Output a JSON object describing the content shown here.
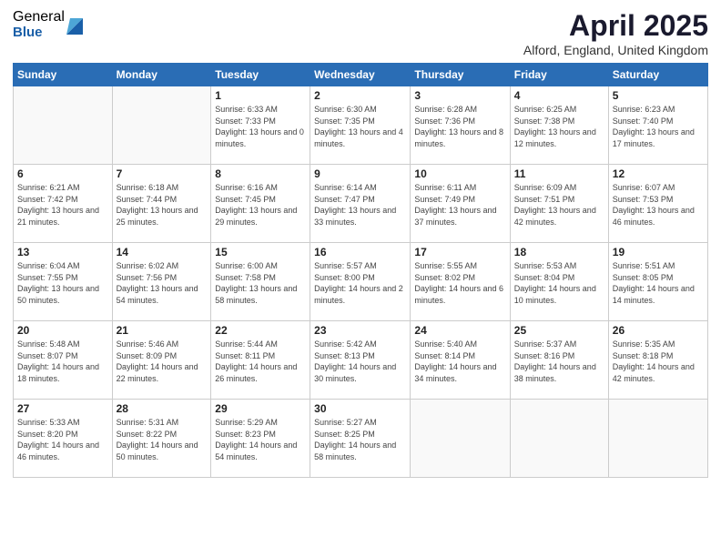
{
  "logo": {
    "general": "General",
    "blue": "Blue"
  },
  "title": {
    "month_year": "April 2025",
    "location": "Alford, England, United Kingdom"
  },
  "weekdays": [
    "Sunday",
    "Monday",
    "Tuesday",
    "Wednesday",
    "Thursday",
    "Friday",
    "Saturday"
  ],
  "weeks": [
    [
      {
        "day": "",
        "info": ""
      },
      {
        "day": "",
        "info": ""
      },
      {
        "day": "1",
        "info": "Sunrise: 6:33 AM\nSunset: 7:33 PM\nDaylight: 13 hours and 0 minutes."
      },
      {
        "day": "2",
        "info": "Sunrise: 6:30 AM\nSunset: 7:35 PM\nDaylight: 13 hours and 4 minutes."
      },
      {
        "day": "3",
        "info": "Sunrise: 6:28 AM\nSunset: 7:36 PM\nDaylight: 13 hours and 8 minutes."
      },
      {
        "day": "4",
        "info": "Sunrise: 6:25 AM\nSunset: 7:38 PM\nDaylight: 13 hours and 12 minutes."
      },
      {
        "day": "5",
        "info": "Sunrise: 6:23 AM\nSunset: 7:40 PM\nDaylight: 13 hours and 17 minutes."
      }
    ],
    [
      {
        "day": "6",
        "info": "Sunrise: 6:21 AM\nSunset: 7:42 PM\nDaylight: 13 hours and 21 minutes."
      },
      {
        "day": "7",
        "info": "Sunrise: 6:18 AM\nSunset: 7:44 PM\nDaylight: 13 hours and 25 minutes."
      },
      {
        "day": "8",
        "info": "Sunrise: 6:16 AM\nSunset: 7:45 PM\nDaylight: 13 hours and 29 minutes."
      },
      {
        "day": "9",
        "info": "Sunrise: 6:14 AM\nSunset: 7:47 PM\nDaylight: 13 hours and 33 minutes."
      },
      {
        "day": "10",
        "info": "Sunrise: 6:11 AM\nSunset: 7:49 PM\nDaylight: 13 hours and 37 minutes."
      },
      {
        "day": "11",
        "info": "Sunrise: 6:09 AM\nSunset: 7:51 PM\nDaylight: 13 hours and 42 minutes."
      },
      {
        "day": "12",
        "info": "Sunrise: 6:07 AM\nSunset: 7:53 PM\nDaylight: 13 hours and 46 minutes."
      }
    ],
    [
      {
        "day": "13",
        "info": "Sunrise: 6:04 AM\nSunset: 7:55 PM\nDaylight: 13 hours and 50 minutes."
      },
      {
        "day": "14",
        "info": "Sunrise: 6:02 AM\nSunset: 7:56 PM\nDaylight: 13 hours and 54 minutes."
      },
      {
        "day": "15",
        "info": "Sunrise: 6:00 AM\nSunset: 7:58 PM\nDaylight: 13 hours and 58 minutes."
      },
      {
        "day": "16",
        "info": "Sunrise: 5:57 AM\nSunset: 8:00 PM\nDaylight: 14 hours and 2 minutes."
      },
      {
        "day": "17",
        "info": "Sunrise: 5:55 AM\nSunset: 8:02 PM\nDaylight: 14 hours and 6 minutes."
      },
      {
        "day": "18",
        "info": "Sunrise: 5:53 AM\nSunset: 8:04 PM\nDaylight: 14 hours and 10 minutes."
      },
      {
        "day": "19",
        "info": "Sunrise: 5:51 AM\nSunset: 8:05 PM\nDaylight: 14 hours and 14 minutes."
      }
    ],
    [
      {
        "day": "20",
        "info": "Sunrise: 5:48 AM\nSunset: 8:07 PM\nDaylight: 14 hours and 18 minutes."
      },
      {
        "day": "21",
        "info": "Sunrise: 5:46 AM\nSunset: 8:09 PM\nDaylight: 14 hours and 22 minutes."
      },
      {
        "day": "22",
        "info": "Sunrise: 5:44 AM\nSunset: 8:11 PM\nDaylight: 14 hours and 26 minutes."
      },
      {
        "day": "23",
        "info": "Sunrise: 5:42 AM\nSunset: 8:13 PM\nDaylight: 14 hours and 30 minutes."
      },
      {
        "day": "24",
        "info": "Sunrise: 5:40 AM\nSunset: 8:14 PM\nDaylight: 14 hours and 34 minutes."
      },
      {
        "day": "25",
        "info": "Sunrise: 5:37 AM\nSunset: 8:16 PM\nDaylight: 14 hours and 38 minutes."
      },
      {
        "day": "26",
        "info": "Sunrise: 5:35 AM\nSunset: 8:18 PM\nDaylight: 14 hours and 42 minutes."
      }
    ],
    [
      {
        "day": "27",
        "info": "Sunrise: 5:33 AM\nSunset: 8:20 PM\nDaylight: 14 hours and 46 minutes."
      },
      {
        "day": "28",
        "info": "Sunrise: 5:31 AM\nSunset: 8:22 PM\nDaylight: 14 hours and 50 minutes."
      },
      {
        "day": "29",
        "info": "Sunrise: 5:29 AM\nSunset: 8:23 PM\nDaylight: 14 hours and 54 minutes."
      },
      {
        "day": "30",
        "info": "Sunrise: 5:27 AM\nSunset: 8:25 PM\nDaylight: 14 hours and 58 minutes."
      },
      {
        "day": "",
        "info": ""
      },
      {
        "day": "",
        "info": ""
      },
      {
        "day": "",
        "info": ""
      }
    ]
  ]
}
